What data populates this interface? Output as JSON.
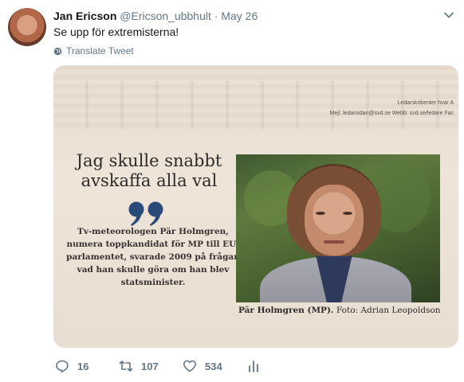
{
  "tweet": {
    "author_name": "Jan Ericson",
    "author_handle": "@Ericson_ubbhult",
    "separator": "·",
    "date": "May 26",
    "text": "Se upp för extremisterna!",
    "translate_label": "Translate Tweet"
  },
  "media": {
    "meta_line1": "Ledarskribenter hvar A",
    "meta_line2": "Mejl: ledarsidan@svd.se  Webb: svd.se/ledare  Fac",
    "headline": "Jag skulle snabbt avskaffa alla val",
    "lede": "Tv-meteorologen Pär Holmgren, numera toppkandidat för MP till EU-parlamentet, svarade 2009 på frågan vad han skulle göra om han blev statsminister.",
    "caption_name": "Pär Holmgren (MP).",
    "caption_credit": "Foto: Adrian Leopoldson"
  },
  "actions": {
    "reply_count": "16",
    "retweet_count": "107",
    "like_count": "534"
  },
  "icons": {
    "caret": "chevron-down-icon",
    "globe": "globe-icon",
    "reply": "reply-icon",
    "retweet": "retweet-icon",
    "like": "heart-icon",
    "stats": "analytics-icon"
  },
  "colors": {
    "text_primary": "#14171a",
    "text_secondary": "#657786",
    "background": "#ffffff"
  }
}
